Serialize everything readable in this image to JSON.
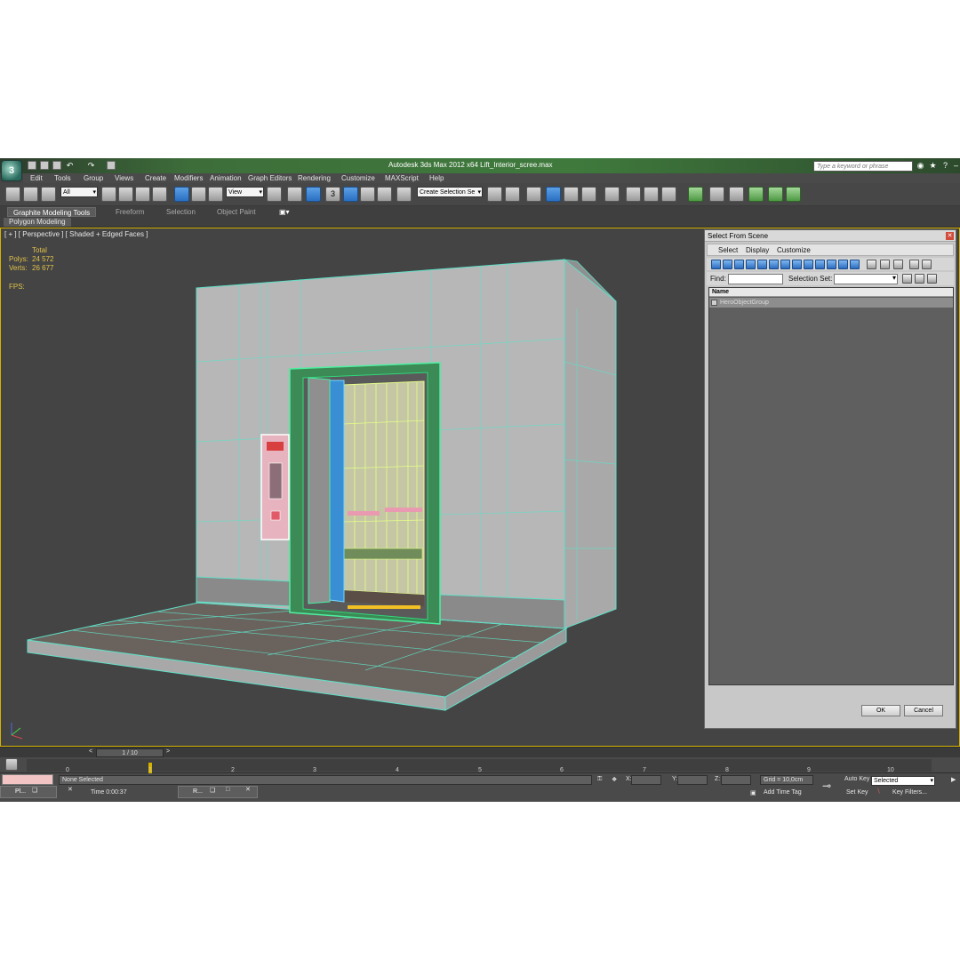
{
  "titlebar": {
    "title": "Autodesk 3ds Max  2012 x64     Lift_Interior_scree.max",
    "search_placeholder": "Type a keyword or phrase"
  },
  "menu": [
    "Edit",
    "Tools",
    "Group",
    "Views",
    "Create",
    "Modifiers",
    "Animation",
    "Graph Editors",
    "Rendering",
    "Customize",
    "MAXScript",
    "Help"
  ],
  "toolbar": {
    "filter_value": "All",
    "reference_coord": "View",
    "snap_label": "3",
    "named_selection_placeholder": "Create Selection Se"
  },
  "ribbon": {
    "tabs": [
      "Graphite Modeling Tools",
      "Freeform",
      "Selection",
      "Object Paint"
    ],
    "sub_panel": "Polygon Modeling"
  },
  "viewport": {
    "label": "[ + ] [ Perspective ] [ Shaded + Edged Faces ]",
    "stats": {
      "header": "Total",
      "polys_label": "Polys:",
      "polys_value": "24 572",
      "verts_label": "Verts:",
      "verts_value": "26 677",
      "fps_label": "FPS:"
    }
  },
  "dialog": {
    "title": "Select From Scene",
    "menu": [
      "Select",
      "Display",
      "Customize"
    ],
    "find_label": "Find:",
    "selection_set_label": "Selection Set:",
    "column_header": "Name",
    "items": [
      "HeroObjectGroup"
    ],
    "ok_label": "OK",
    "cancel_label": "Cancel"
  },
  "timeline": {
    "slider_label": "1 / 10",
    "frames": [
      "0",
      "1",
      "2",
      "3",
      "4",
      "5",
      "6",
      "7",
      "8",
      "9",
      "10"
    ]
  },
  "status": {
    "selection_text": "None Selected",
    "x_label": "X:",
    "y_label": "Y:",
    "z_label": "Z:",
    "grid_text": "Grid = 10,0cm",
    "auto_key_label": "Auto Key",
    "auto_key_mode": "Selected",
    "set_key_label": "Set Key",
    "key_filters_label": "Key Filters...",
    "add_time_tag_label": "Add Time Tag",
    "time_text": "Time  0:00:37",
    "taskbar_1": "Pl...",
    "taskbar_2": "R..."
  }
}
